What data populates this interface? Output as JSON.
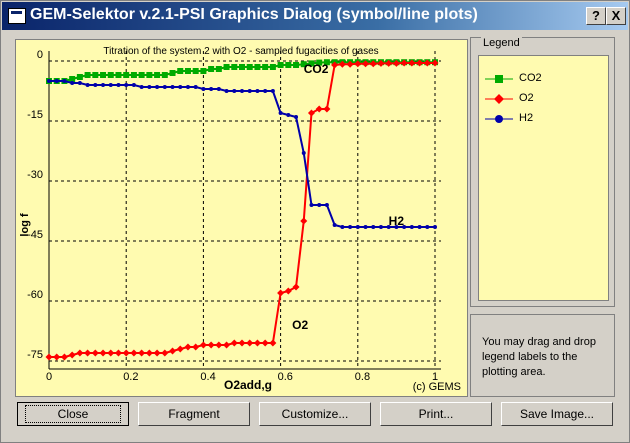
{
  "window": {
    "title": "GEM-Selektor v.2.1-PSI Graphics Dialog (symbol/line plots)",
    "help_button": "?",
    "close_button": "X"
  },
  "legend": {
    "title": "Legend",
    "items": [
      {
        "label": "CO2",
        "color": "#00aa00",
        "marker": "square"
      },
      {
        "label": "O2",
        "color": "#ff0000",
        "marker": "diamond"
      },
      {
        "label": "H2",
        "color": "#0000aa",
        "marker": "circle"
      }
    ]
  },
  "hint": "You may drag and drop legend labels to the plotting area.",
  "buttons": {
    "close": "Close",
    "fragment": "Fragment",
    "customize": "Customize...",
    "print": "Print...",
    "save_image": "Save Image..."
  },
  "chart_data": {
    "type": "line",
    "title": "Titration of the system 2 with O2 - sampled fugacities of gases",
    "xlabel": "O2add,g",
    "ylabel": "log f",
    "credit": "(c) GEMS",
    "xlim": [
      0,
      1
    ],
    "ylim": [
      -75,
      0
    ],
    "xticks": [
      0,
      0.2,
      0.4,
      0.6,
      0.8,
      1
    ],
    "xtick_labels": [
      "0",
      "0.2",
      "0.4",
      "0.6",
      "0.8",
      "1"
    ],
    "yticks": [
      0,
      -15,
      -30,
      -45,
      -60,
      -75
    ],
    "ytick_labels": [
      "0",
      "-15",
      "-30",
      "-45",
      "-60",
      "-75"
    ],
    "grid": true,
    "annotations": [
      {
        "text": "CO2",
        "x": 0.66,
        "y": -3
      },
      {
        "text": "H2",
        "x": 0.88,
        "y": -41
      },
      {
        "text": "O2",
        "x": 0.63,
        "y": -67
      }
    ],
    "series": [
      {
        "name": "CO2",
        "color": "#00aa00",
        "marker": "square",
        "x": [
          0,
          0.02,
          0.04,
          0.06,
          0.08,
          0.1,
          0.12,
          0.14,
          0.16,
          0.18,
          0.2,
          0.22,
          0.24,
          0.26,
          0.28,
          0.3,
          0.32,
          0.34,
          0.36,
          0.38,
          0.4,
          0.42,
          0.44,
          0.46,
          0.48,
          0.5,
          0.52,
          0.54,
          0.56,
          0.58,
          0.6,
          0.62,
          0.64,
          0.66,
          0.68,
          0.7,
          0.72,
          0.74,
          0.76,
          0.78,
          0.8,
          0.82,
          0.84,
          0.86,
          0.88,
          0.9,
          0.92,
          0.94,
          0.96,
          0.98,
          1.0
        ],
        "y": [
          -5,
          -5,
          -5,
          -4.5,
          -4,
          -3.5,
          -3.5,
          -3.5,
          -3.5,
          -3.5,
          -3.5,
          -3.5,
          -3.5,
          -3.5,
          -3.5,
          -3.5,
          -3,
          -2.5,
          -2.5,
          -2.5,
          -2.5,
          -2,
          -2,
          -1.5,
          -1.5,
          -1.5,
          -1.5,
          -1.5,
          -1.5,
          -1.5,
          -1,
          -1,
          -1,
          -0.8,
          -0.6,
          -0.4,
          -0.3,
          -0.3,
          -0.3,
          -0.3,
          -0.3,
          -0.3,
          -0.3,
          -0.3,
          -0.3,
          -0.3,
          -0.3,
          -0.3,
          -0.3,
          -0.3,
          -0.3
        ]
      },
      {
        "name": "O2",
        "color": "#ff0000",
        "marker": "diamond",
        "x": [
          0,
          0.02,
          0.04,
          0.06,
          0.08,
          0.1,
          0.12,
          0.14,
          0.16,
          0.18,
          0.2,
          0.22,
          0.24,
          0.26,
          0.28,
          0.3,
          0.32,
          0.34,
          0.36,
          0.38,
          0.4,
          0.42,
          0.44,
          0.46,
          0.48,
          0.5,
          0.52,
          0.54,
          0.56,
          0.58,
          0.6,
          0.62,
          0.64,
          0.66,
          0.68,
          0.7,
          0.72,
          0.74,
          0.76,
          0.78,
          0.8,
          0.82,
          0.84,
          0.86,
          0.88,
          0.9,
          0.92,
          0.94,
          0.96,
          0.98,
          1.0
        ],
        "y": [
          -74,
          -74,
          -74,
          -73.5,
          -73,
          -73,
          -73,
          -73,
          -73,
          -73,
          -73,
          -73,
          -73,
          -73,
          -73,
          -73,
          -72.5,
          -72,
          -71.5,
          -71.5,
          -71,
          -71,
          -71,
          -71,
          -70.5,
          -70.5,
          -70.5,
          -70.5,
          -70.5,
          -70.5,
          -58,
          -57.5,
          -56.5,
          -40,
          -13,
          -12,
          -12,
          -1,
          -0.8,
          -0.8,
          -0.7,
          -0.7,
          -0.7,
          -0.6,
          -0.6,
          -0.6,
          -0.5,
          -0.5,
          -0.5,
          -0.5,
          -0.5
        ]
      },
      {
        "name": "H2",
        "color": "#0000aa",
        "marker": "circle",
        "x": [
          0,
          0.02,
          0.04,
          0.06,
          0.08,
          0.1,
          0.12,
          0.14,
          0.16,
          0.18,
          0.2,
          0.22,
          0.24,
          0.26,
          0.28,
          0.3,
          0.32,
          0.34,
          0.36,
          0.38,
          0.4,
          0.42,
          0.44,
          0.46,
          0.48,
          0.5,
          0.52,
          0.54,
          0.56,
          0.58,
          0.6,
          0.62,
          0.64,
          0.66,
          0.68,
          0.7,
          0.72,
          0.74,
          0.76,
          0.78,
          0.8,
          0.82,
          0.84,
          0.86,
          0.88,
          0.9,
          0.92,
          0.94,
          0.96,
          0.98,
          1.0
        ],
        "y": [
          -5,
          -5,
          -5,
          -5.5,
          -5.5,
          -6,
          -6,
          -6,
          -6,
          -6,
          -6,
          -6,
          -6.5,
          -6.5,
          -6.5,
          -6.5,
          -6.5,
          -6.5,
          -6.5,
          -6.5,
          -7,
          -7,
          -7,
          -7.5,
          -7.5,
          -7.5,
          -7.5,
          -7.5,
          -7.5,
          -7.5,
          -13,
          -13.5,
          -14,
          -23,
          -36,
          -36,
          -36,
          -41,
          -41.5,
          -41.5,
          -41.5,
          -41.5,
          -41.5,
          -41.5,
          -41.5,
          -41.5,
          -41.5,
          -41.5,
          -41.5,
          -41.5,
          -41.5
        ]
      }
    ]
  }
}
